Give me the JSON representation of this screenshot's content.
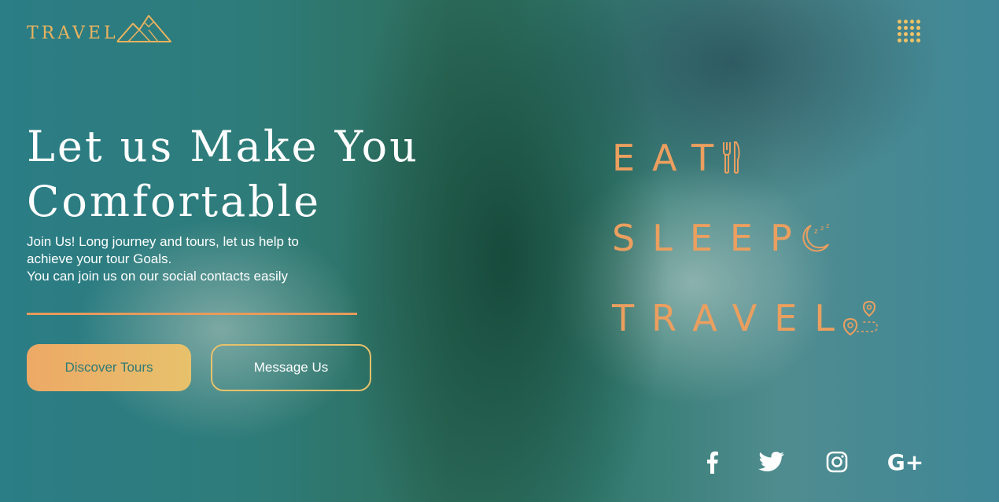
{
  "brand": {
    "name": "TRAVEL"
  },
  "hero": {
    "title_line1": "Let us Make You",
    "title_line2": "Comfortable",
    "desc_line1": "Join Us! Long journey and tours, let us help to",
    "desc_line2": "achieve your tour Goals.",
    "desc_line3": "You can join us on our social contacts easily"
  },
  "buttons": {
    "discover": "Discover Tours",
    "message": "Message Us"
  },
  "features": [
    {
      "label": "EAT",
      "icon": "cutlery-icon"
    },
    {
      "label": "SLEEP",
      "icon": "moon-sleep-icon"
    },
    {
      "label": "TRAVEL",
      "icon": "route-pin-icon"
    }
  ],
  "social": [
    {
      "name": "facebook",
      "icon": "facebook-icon"
    },
    {
      "name": "twitter",
      "icon": "twitter-icon"
    },
    {
      "name": "instagram",
      "icon": "instagram-icon"
    },
    {
      "name": "google-plus",
      "icon": "google-plus-icon",
      "glyph": "G+"
    }
  ],
  "colors": {
    "accent_orange": "#eb9f5f",
    "accent_gold": "#eab35f",
    "button_gradient_start": "#eda966",
    "button_gradient_end": "#e7c16c",
    "text_white": "#ffffff"
  }
}
